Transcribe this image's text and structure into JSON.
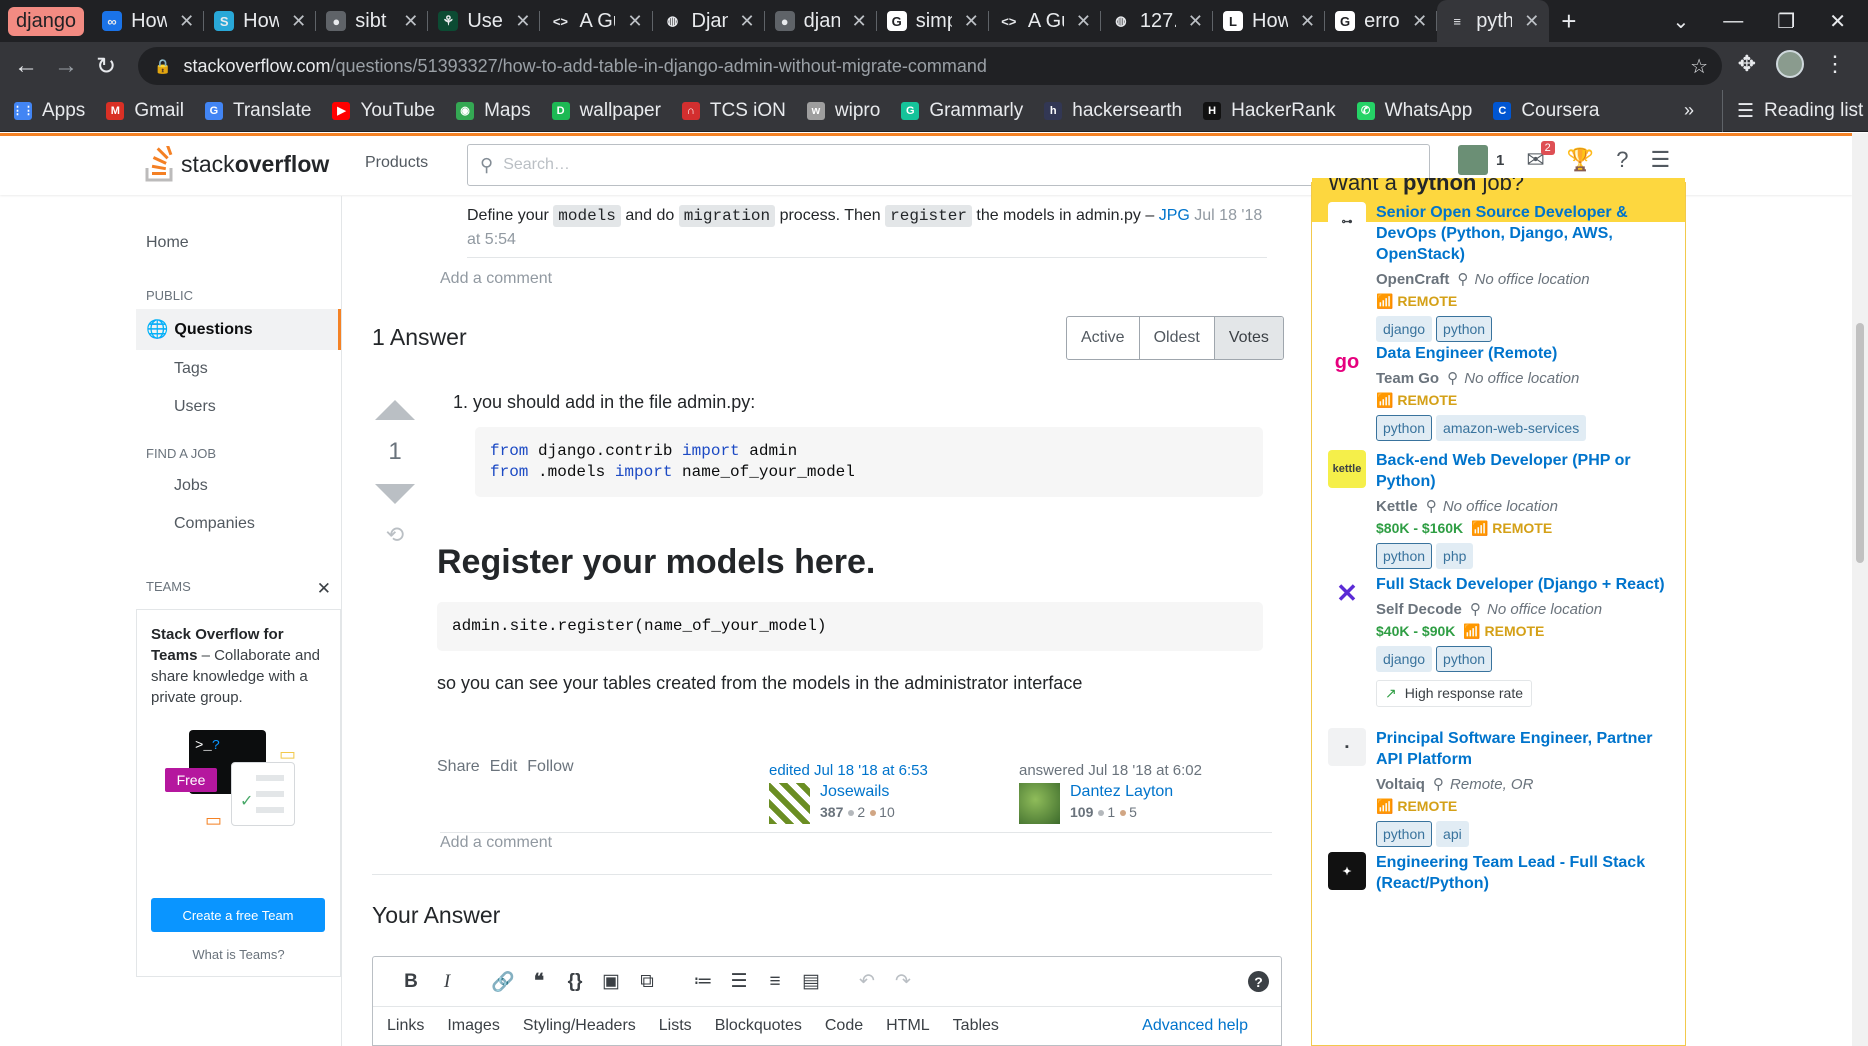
{
  "browser": {
    "tab_group_label": "django",
    "tabs": [
      {
        "title": "How",
        "icon": "infinity-icon",
        "icon_bg": "#1a73e8",
        "icon_char": "∞"
      },
      {
        "title": "How",
        "icon": "s-icon",
        "icon_bg": "#29a8d8",
        "icon_char": "S"
      },
      {
        "title": "sibt",
        "icon": "github-icon",
        "icon_bg": "#5f6368",
        "icon_char": "●"
      },
      {
        "title": "User",
        "icon": "django-icon",
        "icon_bg": "#0c4b33",
        "icon_char": "⚘"
      },
      {
        "title": "A Gu",
        "icon": "code-icon",
        "icon_bg": "#202124",
        "icon_char": "<>"
      },
      {
        "title": "Djan",
        "icon": "globe-icon",
        "icon_bg": "#202124",
        "icon_char": "◍"
      },
      {
        "title": "djan",
        "icon": "github-icon",
        "icon_bg": "#5f6368",
        "icon_char": "●"
      },
      {
        "title": "simp",
        "icon": "google-icon",
        "icon_bg": "#ffffff",
        "icon_char": "G"
      },
      {
        "title": "A Gu",
        "icon": "code-icon",
        "icon_bg": "#202124",
        "icon_char": "<>"
      },
      {
        "title": "127.",
        "icon": "globe-icon",
        "icon_bg": "#202124",
        "icon_char": "◍"
      },
      {
        "title": "How",
        "icon": "l-icon",
        "icon_bg": "#ffffff",
        "icon_char": "L"
      },
      {
        "title": "erro",
        "icon": "google-icon",
        "icon_bg": "#ffffff",
        "icon_char": "G"
      },
      {
        "title": "pyth",
        "icon": "stackoverflow-icon",
        "icon_bg": "#35363a",
        "icon_char": "≡",
        "active": true
      }
    ],
    "url_host": "stackoverflow.com",
    "url_path": "/questions/51393327/how-to-add-table-in-django-admin-without-migrate-command",
    "bookmarks": [
      {
        "label": "Apps",
        "icon_bg": "#4285f4",
        "icon_char": "⋮⋮"
      },
      {
        "label": "Gmail",
        "icon_bg": "#d93025",
        "icon_char": "M"
      },
      {
        "label": "Translate",
        "icon_bg": "#4285f4",
        "icon_char": "G"
      },
      {
        "label": "YouTube",
        "icon_bg": "#ff0000",
        "icon_char": "▶"
      },
      {
        "label": "Maps",
        "icon_bg": "#34a853",
        "icon_char": "◉"
      },
      {
        "label": "wallpaper",
        "icon_bg": "#1db954",
        "icon_char": "D"
      },
      {
        "label": "TCS iON",
        "icon_bg": "#d32f2f",
        "icon_char": "∩"
      },
      {
        "label": "wipro",
        "icon_bg": "#9e9e9e",
        "icon_char": "w"
      },
      {
        "label": "Grammarly",
        "icon_bg": "#15c39a",
        "icon_char": "G"
      },
      {
        "label": "hackersearth",
        "icon_bg": "#323754",
        "icon_char": "h"
      },
      {
        "label": "HackerRank",
        "icon_bg": "#111111",
        "icon_char": "H"
      },
      {
        "label": "WhatsApp",
        "icon_bg": "#25d366",
        "icon_char": "✆"
      },
      {
        "label": "Coursera",
        "icon_bg": "#0056d2",
        "icon_char": "C"
      }
    ],
    "more_label": "»",
    "reading_list": "Reading list"
  },
  "so": {
    "logo_light": "stack",
    "logo_bold": "overflow",
    "products": "Products",
    "search_placeholder": "Search…",
    "rep": "1",
    "inbox_badge": "2",
    "accent": "#f48225"
  },
  "leftnav": {
    "home": "Home",
    "public": "PUBLIC",
    "questions": "Questions",
    "tags": "Tags",
    "users": "Users",
    "find_job": "FIND A JOB",
    "jobs": "Jobs",
    "companies": "Companies",
    "teams": "TEAMS",
    "teams_title_bold": "Stack Overflow for Teams",
    "teams_title_rest": " – Collaborate and share knowledge with a private group.",
    "free": "Free",
    "create_team": "Create a free Team",
    "what_teams": "What is Teams?"
  },
  "question_comment": {
    "t1": "Define your ",
    "c1": "models",
    "t2": " and do ",
    "c2": "migration",
    "t3": " process. Then ",
    "c3": "register",
    "t4": " the models in admin.py – ",
    "user": "JPG",
    "date": "Jul 18 '18 at 5:54"
  },
  "add_comment": "Add a comment",
  "answers": {
    "count_label": "1 Answer",
    "sort_tabs": [
      "Active",
      "Oldest",
      "Votes"
    ],
    "votes": "1",
    "list_item_num": "1.",
    "list_item": "you should add in the file admin.py:",
    "code1_line1_kw1": "from",
    "code1_line1_mid": " django.contrib ",
    "code1_line1_kw2": "import",
    "code1_line1_end": " admin",
    "code1_line2_kw1": "from",
    "code1_line2_mid": " .models ",
    "code1_line2_kw2": "import",
    "code1_line2_end": " name_of_your_model",
    "heading": "Register your models here.",
    "code2": "admin.site.register(name_of_your_model)",
    "para": "so you can see your tables created from the models in the administrator interface",
    "share": "Share",
    "edit": "Edit",
    "follow": "Follow",
    "edited_label": "edited Jul 18 '18 at 6:53",
    "editor_name": "Josewails",
    "editor_rep": "387",
    "editor_silver": "2",
    "editor_bronze": "10",
    "answered_label": "answered Jul 18 '18 at 6:02",
    "author_name": "Dantez Layton",
    "author_rep": "109",
    "author_silver": "1",
    "author_bronze": "5"
  },
  "your_answer": {
    "title": "Your Answer",
    "tabs": [
      "Links",
      "Images",
      "Styling/Headers",
      "Lists",
      "Blockquotes",
      "Code",
      "HTML",
      "Tables"
    ],
    "advanced": "Advanced help"
  },
  "jobs_sidebar": {
    "head_pre": "Want a ",
    "head_bold": "python",
    "head_post": " job?",
    "jobs": [
      {
        "title": "Senior Open Source Developer & DevOps (Python, Django, AWS, OpenStack)",
        "company": "OpenCraft",
        "location": "No office location",
        "salary": "",
        "remote": "REMOTE",
        "tags": [
          "django",
          "python"
        ],
        "logo_bg": "#ffffff",
        "logo_char": "⊶"
      },
      {
        "title": "Data Engineer (Remote)",
        "company": "Team Go",
        "location": "No office location",
        "salary": "",
        "remote": "REMOTE",
        "tags": [
          "python",
          "amazon-web-services"
        ],
        "logo_bg": "#ffffff",
        "logo_char": "go"
      },
      {
        "title": "Back-end Web Developer (PHP or Python)",
        "company": "Kettle",
        "location": "No office location",
        "salary": "$80K - $160K",
        "remote": "REMOTE",
        "tags": [
          "python",
          "php"
        ],
        "logo_bg": "#f5ef4a",
        "logo_char": "kettle"
      },
      {
        "title": "Full Stack Developer (Django + React)",
        "company": "Self Decode",
        "location": "No office location",
        "salary": "$40K - $90K",
        "remote": "REMOTE",
        "tags": [
          "django",
          "python"
        ],
        "extra": "High response rate",
        "logo_bg": "#ffffff",
        "logo_char": "✕"
      },
      {
        "title": "Principal Software Engineer, Partner API Platform",
        "company": "Voltaiq",
        "location": "Remote, OR",
        "salary": "",
        "remote": "REMOTE",
        "tags": [
          "python",
          "api"
        ],
        "logo_bg": "#f1f2f3",
        "logo_char": "▪"
      },
      {
        "title": "Engineering Team Lead - Full Stack (React/Python)",
        "company": "",
        "location": "",
        "salary": "",
        "remote": "",
        "tags": [],
        "logo_bg": "#111111",
        "logo_char": "✦"
      }
    ]
  }
}
